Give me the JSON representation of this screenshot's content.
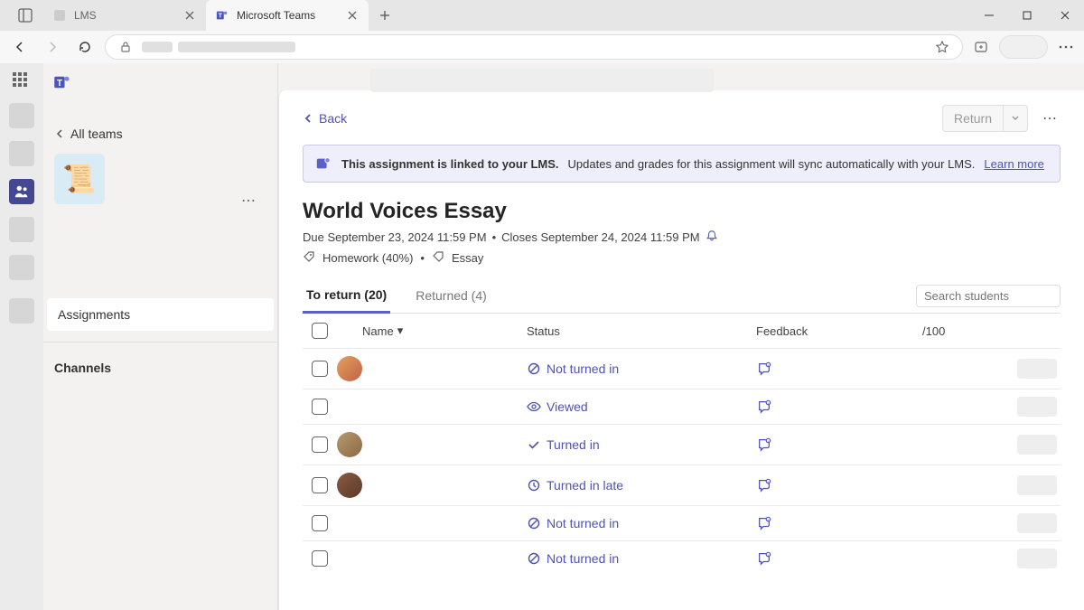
{
  "browser": {
    "tabs": [
      {
        "label": "LMS"
      },
      {
        "label": "Microsoft Teams"
      }
    ]
  },
  "teams_panel": {
    "all_teams": "All teams",
    "assignments_label": "Assignments",
    "channels_label": "Channels"
  },
  "page": {
    "back_label": "Back",
    "return_label": "Return",
    "banner_bold": "This assignment is linked to your LMS.",
    "banner_text": "Updates and grades for this assignment will sync automatically with your LMS.",
    "banner_link": "Learn more",
    "title": "World Voices Essay",
    "due": "Due September 23, 2024 11:59 PM",
    "sep": "•",
    "closes": "Closes September 24, 2024 11:59 PM",
    "homework": "Homework (40%)",
    "essay": "Essay"
  },
  "tabs": {
    "to_return": "To return (20)",
    "returned": "Returned (4)"
  },
  "search": {
    "placeholder": "Search students"
  },
  "columns": {
    "name": "Name",
    "status": "Status",
    "feedback": "Feedback",
    "score": "/100"
  },
  "students": [
    {
      "status": "Not turned in",
      "icon": "block"
    },
    {
      "status": "Viewed",
      "icon": "eye"
    },
    {
      "status": "Turned in",
      "icon": "check"
    },
    {
      "status": "Turned in late",
      "icon": "clock"
    },
    {
      "status": "Not turned in",
      "icon": "block"
    },
    {
      "status": "Not turned in",
      "icon": "block"
    }
  ]
}
